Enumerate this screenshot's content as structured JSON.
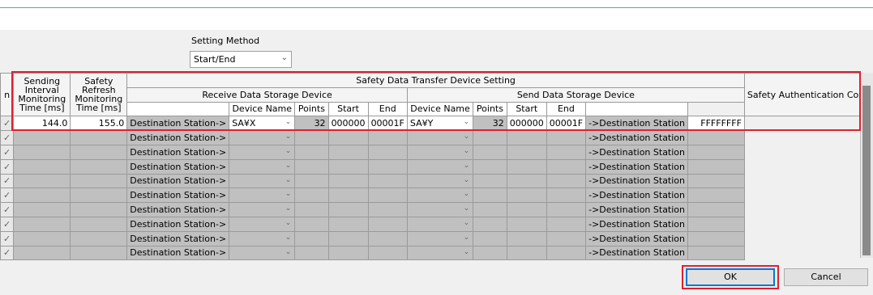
{
  "setting_method": {
    "label": "Setting Method",
    "value": "Start/End"
  },
  "headers": {
    "col0": "n",
    "sending_interval": "Sending Interval Monitoring Time [ms]",
    "safety_refresh": "Safety Refresh Monitoring Time [ms]",
    "transfer_group": "Safety Data Transfer Device Setting",
    "receive_group": "Receive Data Storage Device",
    "send_group": "Send Data Storage Device",
    "auth_code": "Safety Authentication Code",
    "device_name": "Device Name",
    "points": "Points",
    "start": "Start",
    "end": "End"
  },
  "first_row": {
    "sending_interval": "144.0",
    "safety_refresh": "155.0",
    "dest_label": "Destination Station->",
    "recv_device": "SA¥X",
    "recv_points": "32",
    "recv_start": "000000",
    "recv_end": "00001F",
    "send_device": "SA¥Y",
    "send_points": "32",
    "send_start": "000000",
    "send_end": "00001F",
    "dest_label2": "->Destination Station",
    "auth_code": "FFFFFFFF"
  },
  "empty_rows": {
    "dest_label": "Destination Station->",
    "dest_label2": "->Destination Station"
  },
  "buttons": {
    "ok": "OK",
    "cancel": "Cancel"
  }
}
